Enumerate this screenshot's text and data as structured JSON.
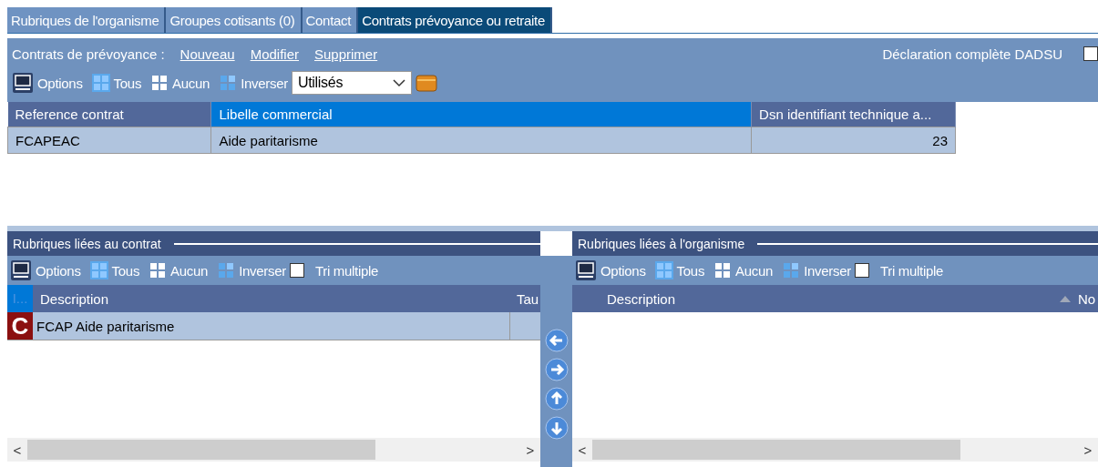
{
  "tabs": [
    {
      "label": "Rubriques de l'organisme",
      "selected": false
    },
    {
      "label": "Groupes cotisants (0)",
      "selected": false
    },
    {
      "label": "Contact",
      "selected": false
    },
    {
      "label": "Contrats prévoyance ou retraite",
      "selected": true
    }
  ],
  "contracts": {
    "label": "Contrats de prévoyance :",
    "links": [
      "Nouveau",
      "Modifier",
      "Supprimer"
    ],
    "dadsu": {
      "label": "Déclaration complète DADSU",
      "checked": false
    },
    "toolbar": {
      "options": "Options",
      "all": "Tous",
      "none": "Aucun",
      "invert": "Inverser",
      "filter": "Utilisés"
    },
    "table": {
      "columns": [
        {
          "label": "Reference contrat",
          "selected": false
        },
        {
          "label": "Libelle commercial",
          "selected": true
        },
        {
          "label": "Dsn identifiant technique a...",
          "selected": false
        }
      ],
      "rows": [
        {
          "cells": [
            "FCAPEAC",
            "Aide paritarisme",
            "23"
          ]
        }
      ]
    }
  },
  "linked_contract": {
    "title": "Rubriques liées au contrat",
    "toolbar": {
      "options": "Options",
      "all": "Tous",
      "none": "Aucun",
      "invert": "Inverser",
      "multi_sort": {
        "label": "Tri multiple",
        "checked": false
      }
    },
    "columns": [
      "I...",
      "Description",
      "Tau"
    ],
    "rows": [
      {
        "badge": "C",
        "description": "FCAP Aide paritarisme"
      }
    ],
    "scroll": [
      "<",
      ">"
    ]
  },
  "linked_org": {
    "title": "Rubriques liées à l'organisme",
    "toolbar": {
      "options": "Options",
      "all": "Tous",
      "none": "Aucun",
      "invert": "Inverser",
      "multi_sort": {
        "label": "Tri multiple",
        "checked": false
      }
    },
    "columns": [
      "Description",
      "No"
    ],
    "scroll": [
      "<",
      ">"
    ]
  }
}
